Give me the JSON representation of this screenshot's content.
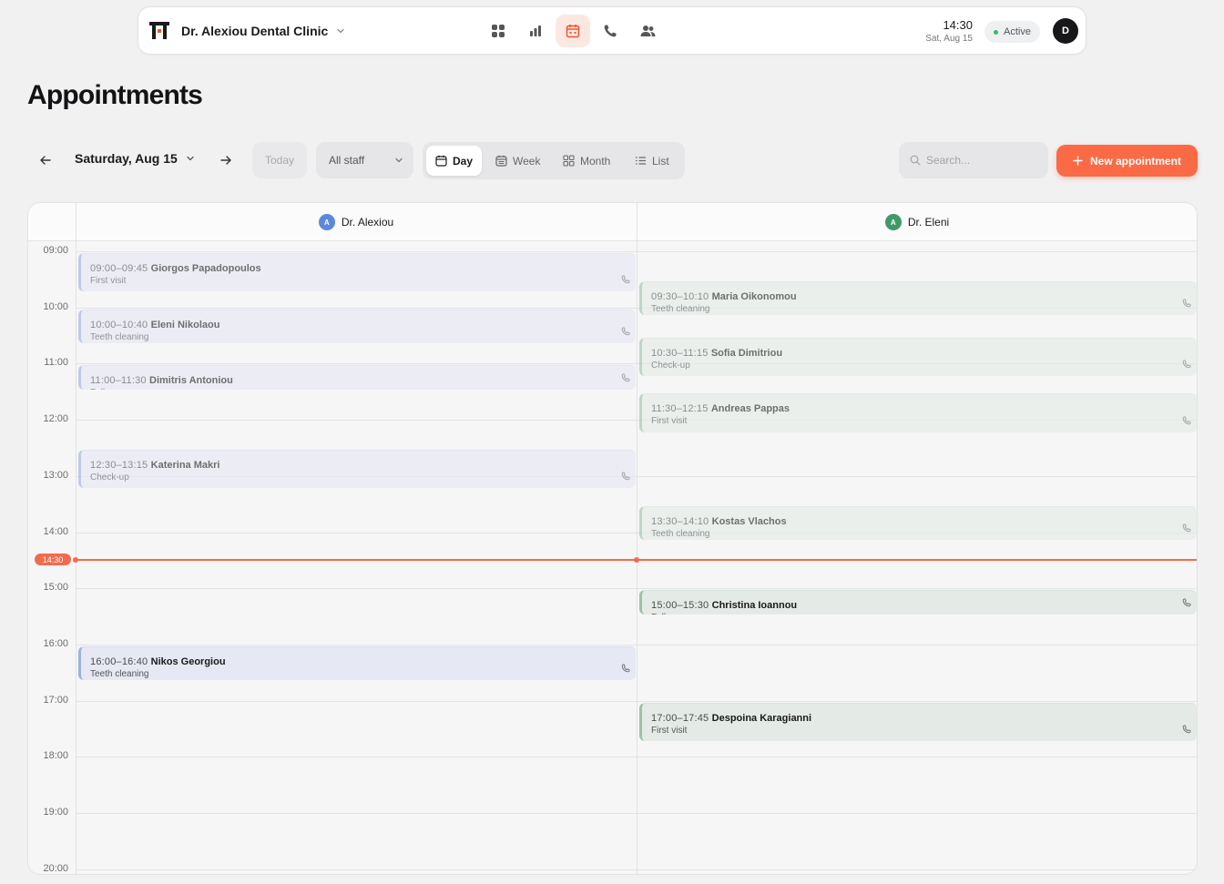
{
  "topbar": {
    "clinic_name": "Dr. Alexiou Dental Clinic",
    "time": "14:30",
    "date": "Sat, Aug 15",
    "status": "Active",
    "avatar_initial": "D",
    "accent_color": "#fa6a45"
  },
  "page": {
    "title": "Appointments"
  },
  "toolbar": {
    "date_label": "Saturday, Aug 15",
    "today_label": "Today",
    "staff_filter": "All staff",
    "views": [
      "Day",
      "Week",
      "Month",
      "List"
    ],
    "active_view": "Day",
    "search_placeholder": "Search...",
    "new_button_label": "New appointment"
  },
  "calendar": {
    "hours": [
      "09:00",
      "10:00",
      "11:00",
      "12:00",
      "13:00",
      "14:00",
      "15:00",
      "16:00",
      "17:00",
      "18:00",
      "19:00",
      "20:00"
    ],
    "now_label": "14:30",
    "doctors": [
      {
        "name": "Dr. Alexiou",
        "initial": "A",
        "color": "#5b87e0"
      },
      {
        "name": "Dr. Eleni",
        "initial": "A",
        "color": "#3f9a67"
      }
    ],
    "appointments": [
      {
        "doctor": 0,
        "time": "09:00–09:45",
        "patient": "Giorgos Papadopoulos",
        "type": "First visit"
      },
      {
        "doctor": 0,
        "time": "10:00–10:40",
        "patient": "Eleni Nikolaou",
        "type": "Teeth cleaning"
      },
      {
        "doctor": 0,
        "time": "11:00–11:30",
        "patient": "Dimitris Antoniou",
        "type": "Follow-up"
      },
      {
        "doctor": 0,
        "time": "12:30–13:15",
        "patient": "Katerina Makri",
        "type": "Check-up"
      },
      {
        "doctor": 0,
        "time": "16:00–16:40",
        "patient": "Nikos Georgiou",
        "type": "Teeth cleaning"
      },
      {
        "doctor": 1,
        "time": "09:30–10:10",
        "patient": "Maria Oikonomou",
        "type": "Teeth cleaning"
      },
      {
        "doctor": 1,
        "time": "10:30–11:15",
        "patient": "Sofia Dimitriou",
        "type": "Check-up"
      },
      {
        "doctor": 1,
        "time": "11:30–12:15",
        "patient": "Andreas Pappas",
        "type": "First visit"
      },
      {
        "doctor": 1,
        "time": "13:30–14:10",
        "patient": "Kostas Vlachos",
        "type": "Teeth cleaning"
      },
      {
        "doctor": 1,
        "time": "15:00–15:30",
        "patient": "Christina Ioannou",
        "type": "Follow-up"
      },
      {
        "doctor": 1,
        "time": "17:00–17:45",
        "patient": "Despoina Karagianni",
        "type": "First visit"
      }
    ]
  }
}
